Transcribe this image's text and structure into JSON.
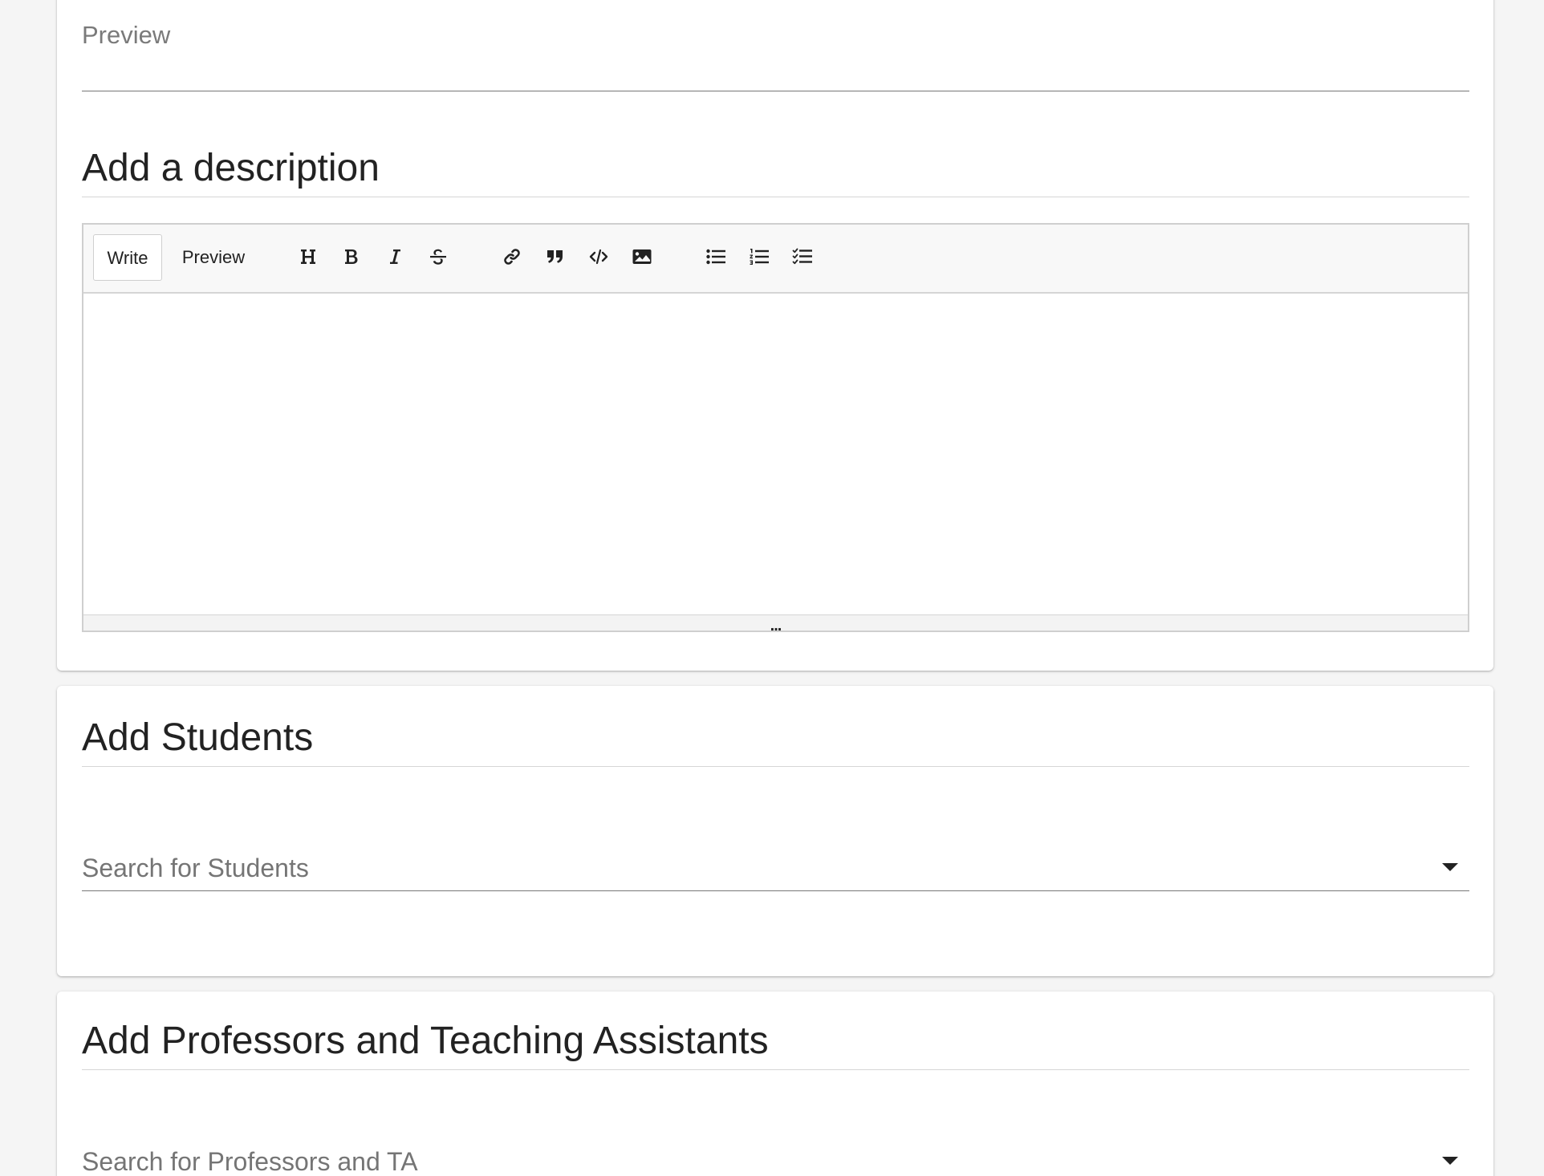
{
  "preview_field": {
    "placeholder": "Preview"
  },
  "description_section": {
    "title": "Add a description",
    "editor": {
      "tabs": [
        {
          "label": "Write",
          "active": true
        },
        {
          "label": "Preview",
          "active": false
        }
      ],
      "toolbar_icons": [
        "heading-icon",
        "bold-icon",
        "italic-icon",
        "strikethrough-icon",
        "link-icon",
        "quote-icon",
        "code-icon",
        "image-icon",
        "unordered-list-icon",
        "ordered-list-icon",
        "checked-list-icon"
      ],
      "content": "",
      "resize_handle": "..."
    }
  },
  "students_section": {
    "title": "Add Students",
    "search_placeholder": "Search for Students"
  },
  "staff_section": {
    "title": "Add Professors and Teaching Assistants",
    "search_placeholder": "Search for Professors and TA"
  },
  "colors": {
    "page_background": "#f5f5f5",
    "card_background": "#ffffff",
    "toolbar_background": "#f8f8f8",
    "placeholder_text": "#757575"
  }
}
